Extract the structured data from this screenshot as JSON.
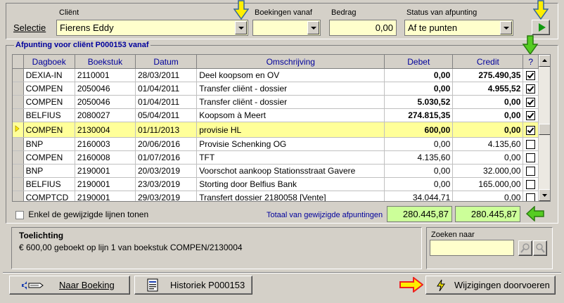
{
  "selectie": {
    "label": "Selectie",
    "client_label": "Cliënt",
    "client_value": "Fierens Eddy",
    "boekingen_label": "Boekingen vanaf",
    "boekingen_value": "",
    "bedrag_label": "Bedrag",
    "bedrag_value": "0,00",
    "status_label": "Status van afpunting",
    "status_value": "Af te punten"
  },
  "grid": {
    "title": "Afpunting voor cliënt P000153 vanaf",
    "columns": [
      "Dagboek",
      "Boekstuk",
      "Datum",
      "Omschrijving",
      "Debet",
      "Credit",
      "?"
    ],
    "rows": [
      {
        "dagboek": "DEXIA-IN",
        "boekstuk": "2110001",
        "datum": "28/03/2011",
        "omschrijving": "Deel koopsom en OV",
        "debet": "0,00",
        "credit": "275.490,35",
        "checked": true,
        "bold": true,
        "selected": false
      },
      {
        "dagboek": "COMPEN",
        "boekstuk": "2050046",
        "datum": "01/04/2011",
        "omschrijving": "Transfer cliënt - dossier",
        "debet": "0,00",
        "credit": "4.955,52",
        "checked": true,
        "bold": true,
        "selected": false
      },
      {
        "dagboek": "COMPEN",
        "boekstuk": "2050046",
        "datum": "01/04/2011",
        "omschrijving": "Transfer cliënt - dossier",
        "debet": "5.030,52",
        "credit": "0,00",
        "checked": true,
        "bold": true,
        "selected": false
      },
      {
        "dagboek": "BELFIUS",
        "boekstuk": "2080027",
        "datum": "05/04/2011",
        "omschrijving": "Koopsom à Meert",
        "debet": "274.815,35",
        "credit": "0,00",
        "checked": true,
        "bold": true,
        "selected": false
      },
      {
        "dagboek": "COMPEN",
        "boekstuk": "2130004",
        "datum": "01/11/2013",
        "omschrijving": "provisie HL",
        "debet": "600,00",
        "credit": "0,00",
        "checked": true,
        "bold": true,
        "selected": true
      },
      {
        "dagboek": "BNP",
        "boekstuk": "2160003",
        "datum": "20/06/2016",
        "omschrijving": "Provisie Schenking OG",
        "debet": "0,00",
        "credit": "4.135,60",
        "checked": false,
        "bold": false,
        "selected": false
      },
      {
        "dagboek": "COMPEN",
        "boekstuk": "2160008",
        "datum": "01/07/2016",
        "omschrijving": "TFT",
        "debet": "4.135,60",
        "credit": "0,00",
        "checked": false,
        "bold": false,
        "selected": false
      },
      {
        "dagboek": "BNP",
        "boekstuk": "2190001",
        "datum": "20/03/2019",
        "omschrijving": "Voorschot aankoop Stationsstraat Gavere",
        "debet": "0,00",
        "credit": "32.000,00",
        "checked": false,
        "bold": false,
        "selected": false
      },
      {
        "dagboek": "BELFIUS",
        "boekstuk": "2190001",
        "datum": "23/03/2019",
        "omschrijving": "Storting door Belfius Bank",
        "debet": "0,00",
        "credit": "165.000,00",
        "checked": false,
        "bold": false,
        "selected": false
      },
      {
        "dagboek": "COMPTCD",
        "boekstuk": "2190001",
        "datum": "29/03/2019",
        "omschrijving": "Transfert dossier 2180058 [Vente]",
        "debet": "34.044,71",
        "credit": "0,00",
        "checked": false,
        "bold": false,
        "selected": false
      }
    ]
  },
  "footer": {
    "only_changed_label": "Enkel de gewijzigde lijnen tonen",
    "totaal_label": "Totaal van gewijzigde afpuntingen",
    "totaal_debet": "280.445,87",
    "totaal_credit": "280.445,87"
  },
  "toelichting": {
    "title": "Toelichting",
    "text": "€ 600,00 geboekt op lijn 1 van boekstuk COMPEN/2130004"
  },
  "zoeken": {
    "label": "Zoeken naar",
    "value": ""
  },
  "buttons": {
    "naar_boeking": "Naar Boeking",
    "historiek": "Historiek P000153",
    "wijzigingen": "Wijzigingen doorvoeren"
  },
  "colors": {
    "field_bg": "#ffffcc",
    "selected_row": "#ffff99",
    "total_bg": "#ccff99",
    "arrow_yellow": "#ffee00",
    "arrow_green": "#55cc22",
    "arrow_red": "#ee2222"
  }
}
